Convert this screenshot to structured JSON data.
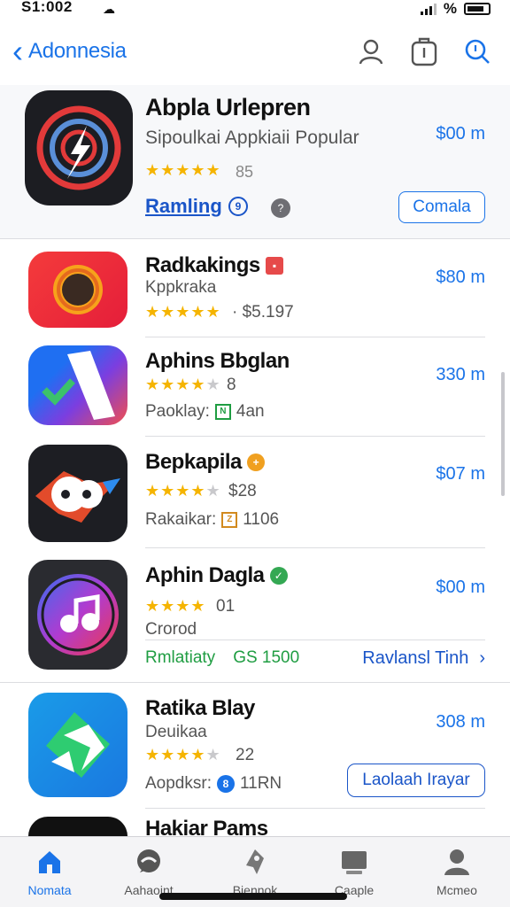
{
  "status_bar": {
    "time": "S1:002",
    "battery_label": "%"
  },
  "nav": {
    "back_label": "Adonnesia",
    "icons": [
      "person-icon",
      "bag-icon",
      "search-icon"
    ]
  },
  "hero": {
    "title": "Abpla Urlepren",
    "subtitle": "Sipoulkai Appkiaii Popular",
    "price": "$00 m",
    "stars": "★★★★★",
    "rating": "85",
    "link_label": "Ramling",
    "link_icon": "9",
    "dot_icon": "?",
    "button_label": "Comala"
  },
  "apps": [
    {
      "name": "Radkakings",
      "subtitle": "Kppkraka",
      "stars_full": "★★★★★",
      "stars_dim": "",
      "meta": "· $5.197",
      "price": "$80 m",
      "badge": "▪",
      "badge_color": "#e64a4a"
    },
    {
      "name": "Aphins Bbglan",
      "stars_full": "★★★★",
      "stars_dim": "★",
      "meta": "8",
      "price": "330 m",
      "extra_label": "Paoklay:",
      "extra_tag": "N",
      "extra_text": "4an",
      "extra_color": "#1f9d42"
    },
    {
      "name": "Bepkapila",
      "stars_full": "★★★★",
      "stars_dim": "★",
      "meta": "$28",
      "price": "$07 m",
      "badge": "+",
      "badge_color": "#f0a020",
      "extra_label": "Rakaikar:",
      "extra_tag": "Z",
      "extra_text": "1106",
      "extra_color": "#d28a1e"
    },
    {
      "name": "Aphin Dagla",
      "subtitle": "Crorod",
      "stars_full": "★★★★",
      "stars_dim": "",
      "meta": "01",
      "price": "$00 m",
      "badge": "✓",
      "badge_color": "#34a853",
      "extra_label": "Rmlatiaty",
      "extra_text": "GS 1500",
      "link_label": "Ravlansl Tinh"
    },
    {
      "name": "Ratika Blay",
      "subtitle": "Deuikaa",
      "stars_full": "★★★★",
      "stars_dim": "★",
      "meta": "22",
      "price": "308 m",
      "extra_label": "Aopdksr:",
      "extra_tag": "8",
      "extra_text": "11RN",
      "button_label": "Laolaah Irayar"
    },
    {
      "name": "Hakiar Pams"
    }
  ],
  "tabs": [
    {
      "label": "Nomata",
      "icon": "home-icon",
      "active": true
    },
    {
      "label": "Aahaoint",
      "icon": "chat-icon",
      "active": false
    },
    {
      "label": "Biennok",
      "icon": "rocket-icon",
      "active": false
    },
    {
      "label": "Caaple",
      "icon": "stack-icon",
      "active": false
    },
    {
      "label": "Mcmeo",
      "icon": "profile-icon",
      "active": false
    }
  ]
}
